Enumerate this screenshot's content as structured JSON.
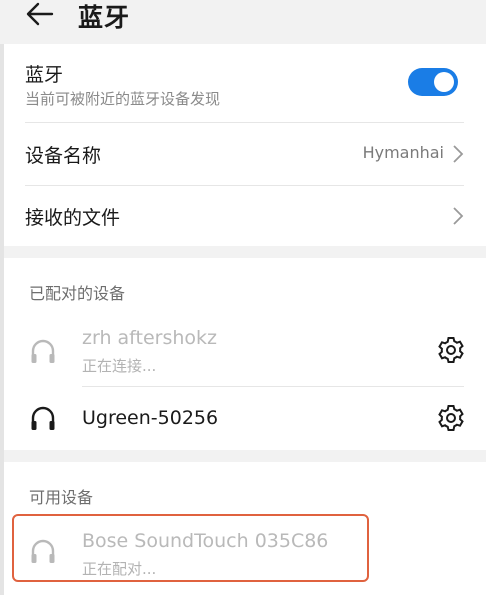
{
  "header": {
    "title": "蓝牙"
  },
  "bluetooth": {
    "label": "蓝牙",
    "subtitle": "当前可被附近的蓝牙设备发现",
    "enabled": true,
    "accent_color": "#1a7de6"
  },
  "device_name": {
    "label": "设备名称",
    "value": "Hymanhai"
  },
  "received_files": {
    "label": "接收的文件"
  },
  "paired": {
    "section_label": "已配对的设备",
    "devices": [
      {
        "name": "zrh aftershokz",
        "status": "正在连接...",
        "icon": "headphones-icon"
      },
      {
        "name": "Ugreen-50256",
        "status": "",
        "icon": "headphones-icon"
      }
    ]
  },
  "available": {
    "section_label": "可用设备",
    "devices": [
      {
        "name": "Bose SoundTouch 035C86",
        "status": "正在配对...",
        "icon": "headphones-icon"
      }
    ]
  },
  "highlight_color": "#e0623f"
}
